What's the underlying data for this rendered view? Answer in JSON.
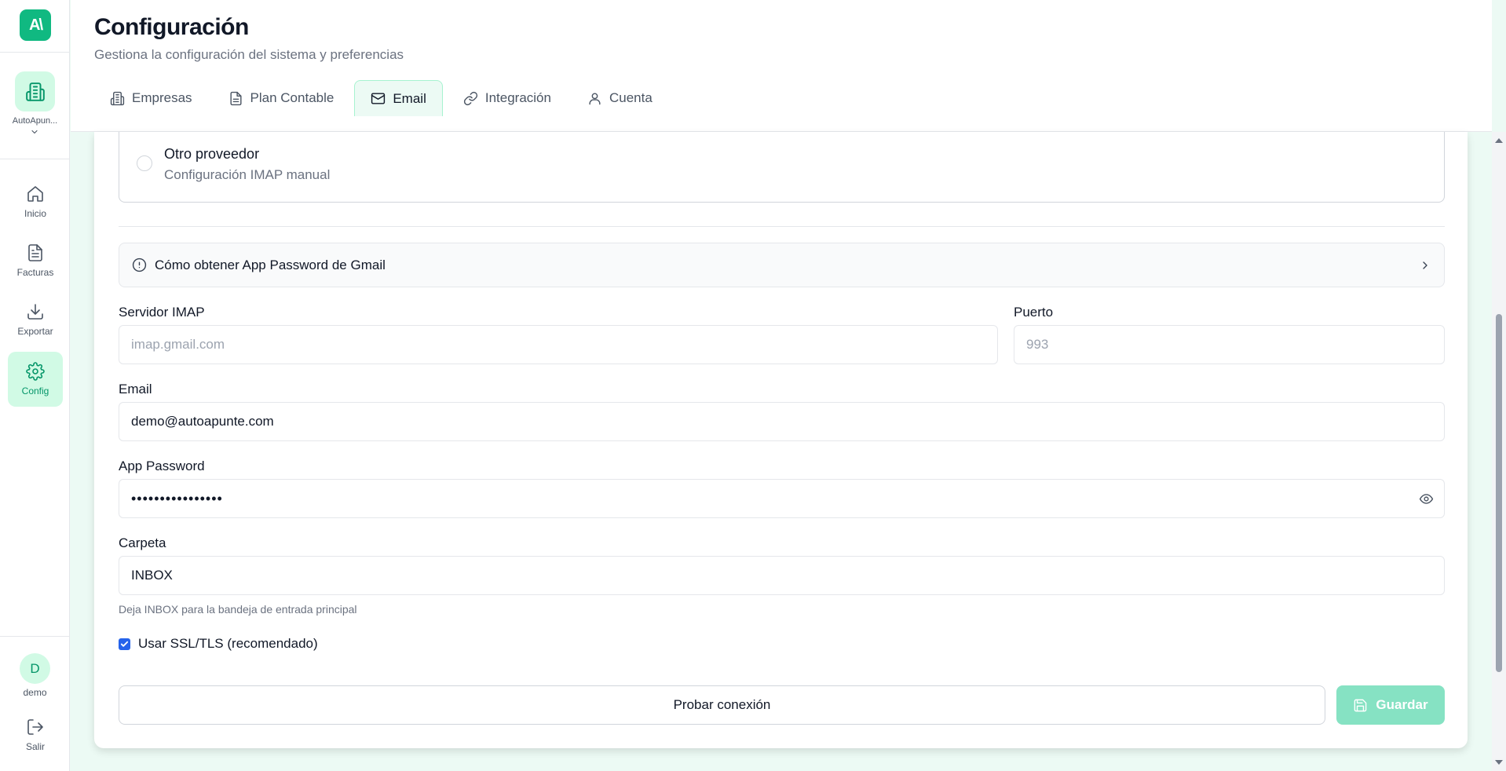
{
  "app": {
    "logo_text": "A\\"
  },
  "sidebar": {
    "company": {
      "name": "AutoApun..."
    },
    "items": [
      {
        "label": "Inicio",
        "icon": "home-icon"
      },
      {
        "label": "Facturas",
        "icon": "document-icon"
      },
      {
        "label": "Exportar",
        "icon": "download-icon"
      },
      {
        "label": "Config",
        "icon": "gear-icon",
        "active": true
      }
    ],
    "user": {
      "initial": "D",
      "name": "demo"
    },
    "logout_label": "Salir"
  },
  "header": {
    "title": "Configuración",
    "subtitle": "Gestiona la configuración del sistema y preferencias",
    "tabs": [
      {
        "label": "Empresas",
        "icon": "building-icon"
      },
      {
        "label": "Plan Contable",
        "icon": "document-icon"
      },
      {
        "label": "Email",
        "icon": "mail-icon",
        "active": true
      },
      {
        "label": "Integración",
        "icon": "link-icon"
      },
      {
        "label": "Cuenta",
        "icon": "user-icon"
      }
    ]
  },
  "email_form": {
    "provider_option": {
      "title": "Otro proveedor",
      "description": "Configuración IMAP manual"
    },
    "help_title": "Cómo obtener App Password de Gmail",
    "imap_server": {
      "label": "Servidor IMAP",
      "placeholder": "imap.gmail.com"
    },
    "port": {
      "label": "Puerto",
      "placeholder": "993"
    },
    "email": {
      "label": "Email",
      "value": "demo@autoapunte.com"
    },
    "app_password": {
      "label": "App Password",
      "value": "••••••••••••••••"
    },
    "folder": {
      "label": "Carpeta",
      "value": "INBOX",
      "hint": "Deja INBOX para la bandeja de entrada principal"
    },
    "ssl": {
      "label": "Usar SSL/TLS (recomendado)",
      "checked": true
    },
    "test_button": "Probar conexión",
    "save_button": "Guardar"
  },
  "colors": {
    "accent": "#10b981",
    "accent_light": "#d1fae5",
    "page_bg": "#ecfaf4",
    "save_disabled": "#86e2c3"
  }
}
